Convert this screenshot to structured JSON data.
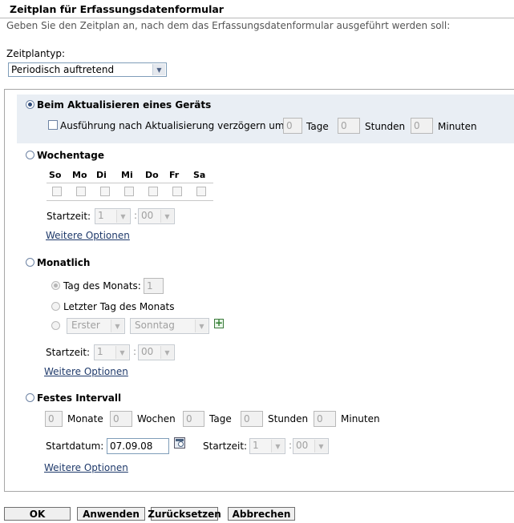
{
  "header": {
    "title": "Zeitplan für Erfassungsdatenformular",
    "subtitle": "Geben Sie den Zeitplan an, nach dem das Erfassungsdatenformular ausgeführt werden soll:"
  },
  "schedule_type": {
    "label": "Zeitplantyp:",
    "value": "Periodisch auftretend"
  },
  "device_refresh": {
    "label": "Beim Aktualisieren eines Geräts",
    "selected": true,
    "delay_label": "Ausführung nach Aktualisierung verzögern um:",
    "days_value": "0",
    "days_label": "Tage",
    "hours_value": "0",
    "hours_label": "Stunden",
    "minutes_value": "0",
    "minutes_label": "Minuten"
  },
  "weekdays": {
    "label": "Wochentage",
    "days": [
      "So",
      "Mo",
      "Di",
      "Mi",
      "Do",
      "Fr",
      "Sa"
    ],
    "start_label": "Startzeit:",
    "hour": "1",
    "minute": "00",
    "more": "Weitere Optionen"
  },
  "monthly": {
    "label": "Monatlich",
    "day_of_month_label": "Tag des Monats:",
    "day_of_month_value": "1",
    "last_day_label": "Letzter Tag des Monats",
    "ordinal": "Erster",
    "weekday": "Sonntag",
    "start_label": "Startzeit:",
    "hour": "1",
    "minute": "00",
    "more": "Weitere Optionen"
  },
  "fixed_interval": {
    "label": "Festes Intervall",
    "months_value": "0",
    "months_label": "Monate",
    "weeks_value": "0",
    "weeks_label": "Wochen",
    "days_value": "0",
    "days_label": "Tage",
    "hours_value": "0",
    "hours_label": "Stunden",
    "minutes_value": "0",
    "minutes_label": "Minuten",
    "start_date_label": "Startdatum:",
    "start_date_value": "07.09.08",
    "start_time_label": "Startzeit:",
    "hour": "1",
    "minute": "00",
    "more": "Weitere Optionen"
  },
  "buttons": {
    "ok": "OK",
    "apply": "Anwenden",
    "reset": "Zurücksetzen",
    "cancel": "Abbrechen"
  }
}
